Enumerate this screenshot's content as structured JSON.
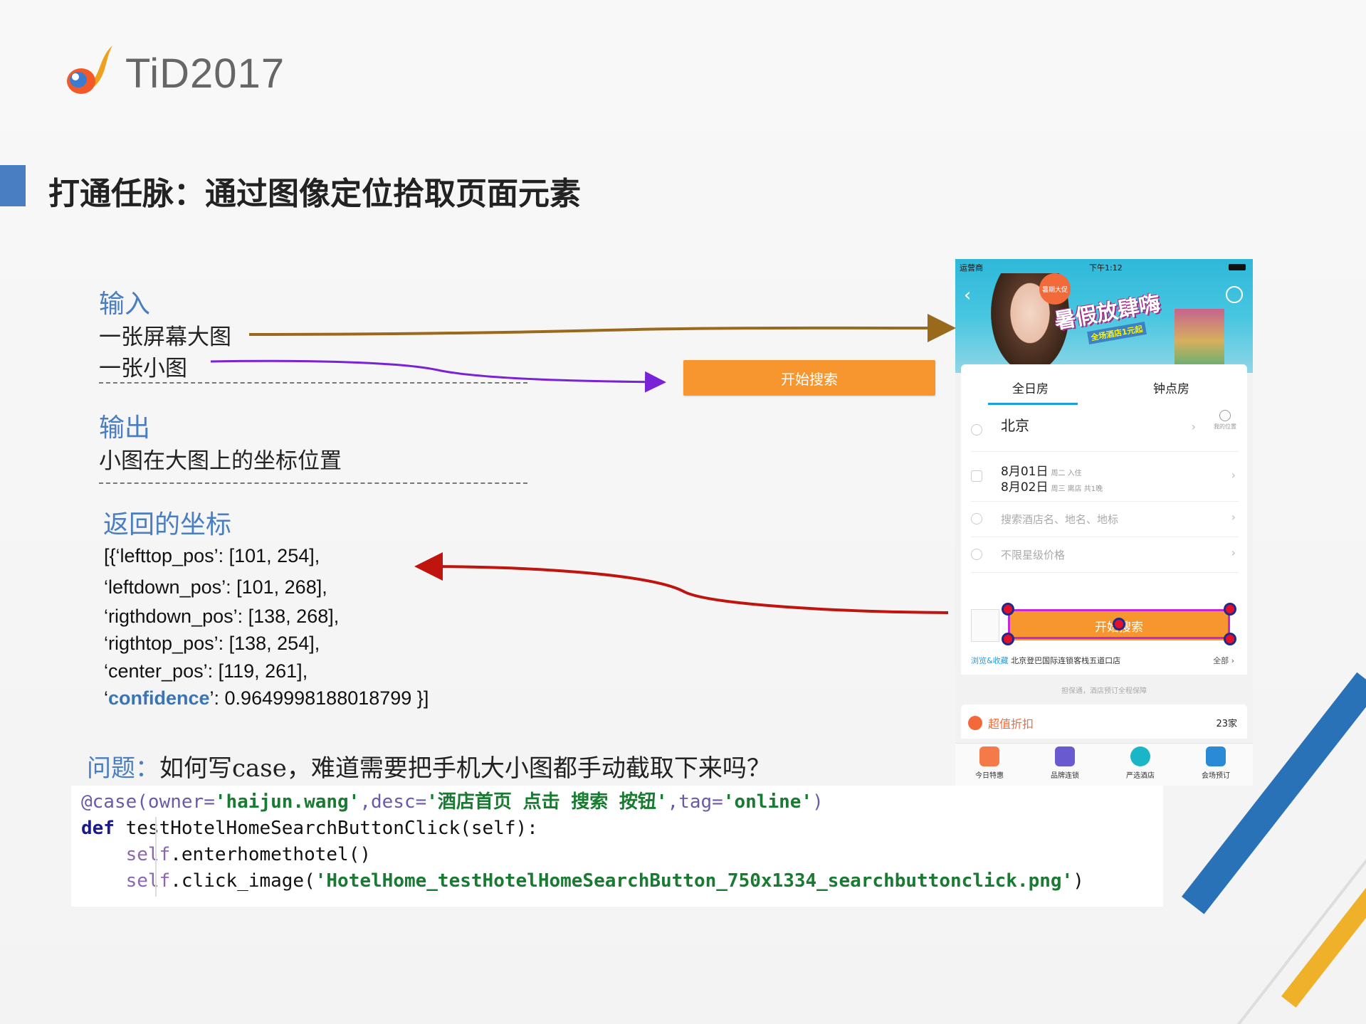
{
  "logo": {
    "text": "TiD2017"
  },
  "title": "打通任脉：通过图像定位拾取页面元素",
  "input": {
    "label": "输入",
    "line1": "一张屏幕大图",
    "line2": "一张小图"
  },
  "output": {
    "label": "输出",
    "line1": "小图在大图上的坐标位置"
  },
  "coords": {
    "label": "返回的坐标",
    "lines": [
      "[{‘lefttop_pos’: [101, 254],",
      "‘leftdown_pos’: [101, 268],",
      "‘rigthdown_pos’: [138, 268],",
      " ‘rigthtop_pos’: [138, 254],",
      "‘center_pos’: [119, 261],"
    ],
    "conf_prefix": "‘",
    "conf_key": "confidence",
    "conf_suffix": "’: 0.9649998188018799 }]"
  },
  "sample_button": {
    "label": "开始搜索"
  },
  "question": {
    "label": "问题：",
    "text": "如何写case，难道需要把手机大小图都手动截取下来吗？"
  },
  "code": {
    "decorator": "@case(",
    "kw_owner": "owner=",
    "owner": "'haijun.wang'",
    "kw_desc": ",desc=",
    "desc": "'酒店首页 点击 搜索 按钮'",
    "kw_tag": ",tag=",
    "tag": "'online'",
    "close": ")",
    "def_kw": "def",
    "def_rest": " testHotelHomeSearchButtonClick(self):",
    "line3_self": "self",
    "line3_rest": ".enterhomethotel()",
    "line4_self": "self",
    "line4_mid": ".click_image(",
    "line4_str": "'HotelHome_testHotelHomeSearchButton_750x1334_searchbuttonclick.png'",
    "line4_end": ")"
  },
  "phone": {
    "status": {
      "carrier": "运营商",
      "time": "下午1:12"
    },
    "promo": "暑假放肆嗨",
    "promo_sub": "全场酒店1元起",
    "badge": "暑期大促",
    "tabs": [
      "全日房",
      "钟点房"
    ],
    "city": "北京",
    "my_location": "我的位置",
    "checkin": {
      "date": "8月01日",
      "note": "周二 入住"
    },
    "checkout": {
      "date": "8月02日",
      "note": "周三 离店 共1晚"
    },
    "search_placeholder": "搜索酒店名、地名、地标",
    "price_placeholder": "不限星级价格",
    "search_button": "开始搜索",
    "history_label": "浏览&收藏",
    "history_item": "北京登巴国际连锁客栈五道口店",
    "history_all": "全部 ›",
    "guarantee": "担保通，酒店预订全程保障",
    "discount": {
      "label": "超值折扣",
      "count": "23家"
    },
    "nav": [
      "今日特惠",
      "品牌连锁",
      "严选酒店",
      "会场预订"
    ]
  },
  "colors": {
    "accent_blue": "#4a7ec2",
    "search_orange": "#f7962e",
    "arrow_brown": "#9a6a1c",
    "arrow_purple": "#7a22d6",
    "arrow_red": "#c0140e",
    "highlight_magenta": "#c02ad8"
  }
}
